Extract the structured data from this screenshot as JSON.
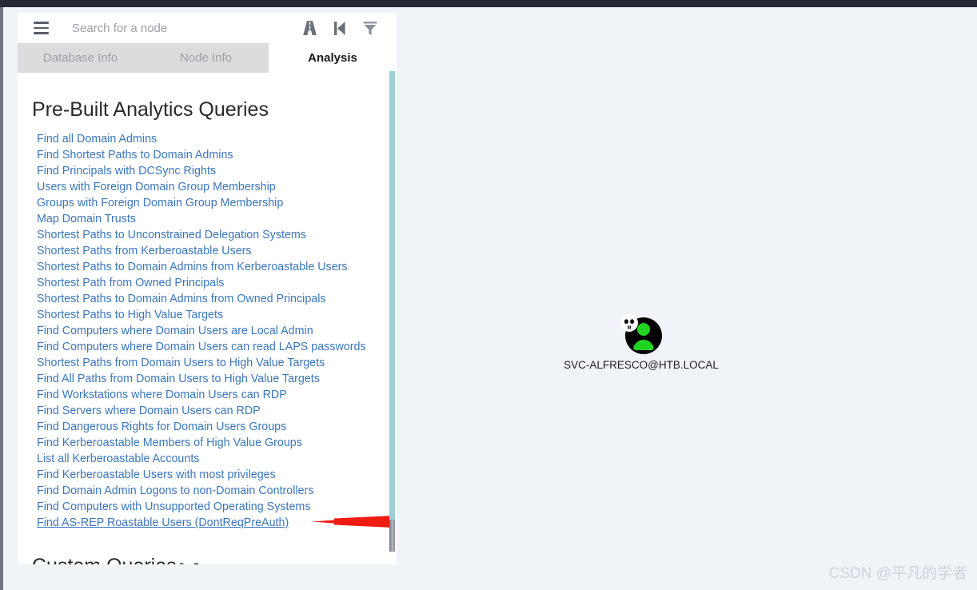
{
  "window": {
    "chrome_bar_color": "#262a35",
    "app_background": "#f0f3f8"
  },
  "search": {
    "placeholder": "Search for a node",
    "value": ""
  },
  "toolbar": {
    "menu_icon": "hamburger-icon",
    "icons": [
      {
        "name": "pathfinding-road-icon",
        "title": "Pathfinding"
      },
      {
        "name": "step-backward-icon",
        "title": "Back"
      },
      {
        "name": "filter-icon",
        "title": "Settings / Filter"
      }
    ]
  },
  "tabs": [
    {
      "label": "Database Info",
      "active": false
    },
    {
      "label": "Node Info",
      "active": false
    },
    {
      "label": "Analysis",
      "active": true
    }
  ],
  "analysis": {
    "prebuilt_heading": "Pre-Built Analytics Queries",
    "custom_heading": "Custom Queries",
    "custom_heading_icons": "✎ ↻",
    "link_color": "#3b77bd",
    "queries": [
      {
        "label": "Find all Domain Admins",
        "highlighted": false
      },
      {
        "label": "Find Shortest Paths to Domain Admins",
        "highlighted": false
      },
      {
        "label": "Find Principals with DCSync Rights",
        "highlighted": false
      },
      {
        "label": "Users with Foreign Domain Group Membership",
        "highlighted": false
      },
      {
        "label": "Groups with Foreign Domain Group Membership",
        "highlighted": false
      },
      {
        "label": "Map Domain Trusts",
        "highlighted": false
      },
      {
        "label": "Shortest Paths to Unconstrained Delegation Systems",
        "highlighted": false
      },
      {
        "label": "Shortest Paths from Kerberoastable Users",
        "highlighted": false
      },
      {
        "label": "Shortest Paths to Domain Admins from Kerberoastable Users",
        "highlighted": false
      },
      {
        "label": "Shortest Path from Owned Principals",
        "highlighted": false
      },
      {
        "label": "Shortest Paths to Domain Admins from Owned Principals",
        "highlighted": false
      },
      {
        "label": "Shortest Paths to High Value Targets",
        "highlighted": false
      },
      {
        "label": "Find Computers where Domain Users are Local Admin",
        "highlighted": false
      },
      {
        "label": "Find Computers where Domain Users can read LAPS passwords",
        "highlighted": false
      },
      {
        "label": "Shortest Paths from Domain Users to High Value Targets",
        "highlighted": false
      },
      {
        "label": "Find All Paths from Domain Users to High Value Targets",
        "highlighted": false
      },
      {
        "label": "Find Workstations where Domain Users can RDP",
        "highlighted": false
      },
      {
        "label": "Find Servers where Domain Users can RDP",
        "highlighted": false
      },
      {
        "label": "Find Dangerous Rights for Domain Users Groups",
        "highlighted": false
      },
      {
        "label": "Find Kerberoastable Members of High Value Groups",
        "highlighted": false
      },
      {
        "label": "List all Kerberoastable Accounts",
        "highlighted": false
      },
      {
        "label": "Find Kerberoastable Users with most privileges",
        "highlighted": false
      },
      {
        "label": "Find Domain Admin Logons to non-Domain Controllers",
        "highlighted": false
      },
      {
        "label": "Find Computers with Unsupported Operating Systems",
        "highlighted": false
      },
      {
        "label": "Find AS-REP Roastable Users (DontReqPreAuth)",
        "highlighted": true
      }
    ]
  },
  "scrollbar": {
    "track_color": "#9dcfd5",
    "thumb_color": "#83888f"
  },
  "graph": {
    "node": {
      "label": "SVC-ALFRESCO@HTB.LOCAL",
      "type": "user-node",
      "owned": true,
      "circle_color": "#000000",
      "person_color": "#22d422",
      "badge": "skull-icon"
    }
  },
  "annotation": {
    "arrow_color": "#f01b12",
    "direction": "left"
  },
  "watermark": {
    "text": "CSDN @平凡的学者"
  }
}
